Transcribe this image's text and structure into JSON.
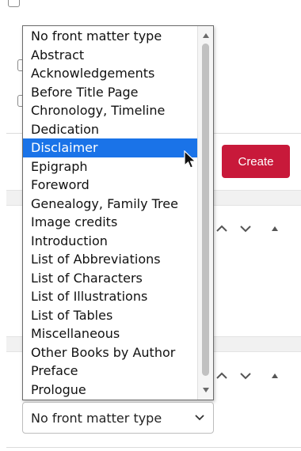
{
  "dropdown": {
    "options": [
      "No front matter type",
      "Abstract",
      "Acknowledgements",
      "Before Title Page",
      "Chronology, Timeline",
      "Dedication",
      "Disclaimer",
      "Epigraph",
      "Foreword",
      "Genealogy, Family Tree",
      "Image credits",
      "Introduction",
      "List of Abbreviations",
      "List of Characters",
      "List of Illustrations",
      "List of Tables",
      "Miscellaneous",
      "Other Books by Author",
      "Preface",
      "Prologue"
    ],
    "highlighted": "Disclaimer"
  },
  "select": {
    "value": "No front matter type"
  },
  "create_button": {
    "label": "Create"
  },
  "colors": {
    "accent": "#c8193a",
    "highlight": "#1a73e8"
  },
  "icons": [
    "chevron-up-icon",
    "chevron-down-icon",
    "caret-up-icon",
    "pointer-cursor-icon"
  ]
}
